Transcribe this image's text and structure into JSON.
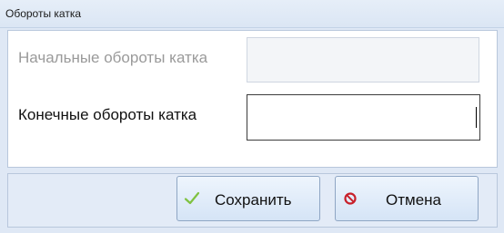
{
  "window": {
    "title": "Обороты катка"
  },
  "form": {
    "start_label": "Начальные обороты катка",
    "start_value": "",
    "end_label": "Конечные обороты катка",
    "end_value": ""
  },
  "buttons": {
    "save_label": "Сохранить",
    "save_icon": "check-icon",
    "cancel_label": "Отмена",
    "cancel_icon": "cancel-icon"
  },
  "colors": {
    "check": "#7fc241",
    "cancel": "#c8202a"
  }
}
